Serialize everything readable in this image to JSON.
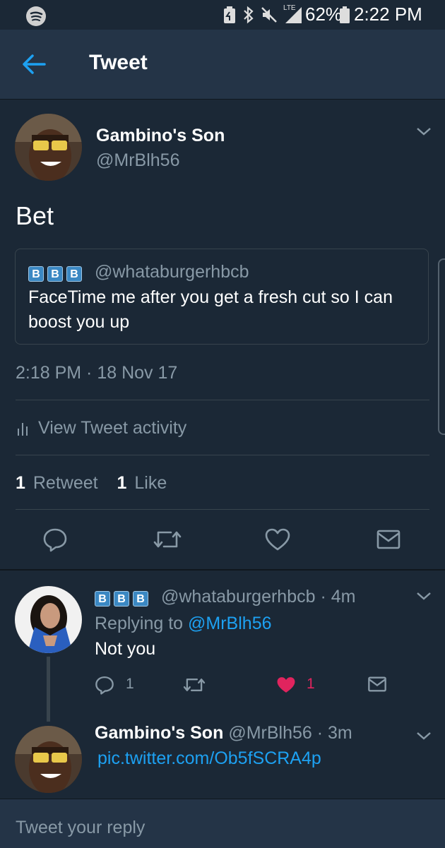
{
  "status_bar": {
    "battery_percent": "62%",
    "time": "2:22 PM",
    "network": "LTE",
    "icons": [
      "spotify-icon",
      "battery-saver-icon",
      "bluetooth-icon",
      "mute-icon",
      "signal-icon",
      "battery-icon"
    ]
  },
  "header": {
    "title": "Tweet"
  },
  "main_tweet": {
    "display_name": "Gambino's Son",
    "handle": "@MrBlh56",
    "text": "Bet",
    "quoted": {
      "badges": [
        "B",
        "B",
        "B"
      ],
      "handle": "@whataburgerhbcb",
      "text_line1": "FaceTime me after you get a fresh cut so I can",
      "text_line2": "boost you up"
    },
    "timestamp": "2:18 PM · 18 Nov 17",
    "activity_label": "View Tweet activity",
    "retweet_count": "1",
    "retweet_label": "Retweet",
    "like_count": "1",
    "like_label": "Like"
  },
  "replies": [
    {
      "badges": [
        "B",
        "B",
        "B"
      ],
      "handle": "@whataburgerhbcb",
      "time": "· 4m",
      "replying_prefix": "Replying to",
      "replying_to": "@MrBlh56",
      "text": "Not you",
      "reply_count": "1",
      "like_count": "1",
      "liked": true
    },
    {
      "display_name": "Gambino's Son",
      "handle": "@MrBlh56",
      "time": "· 3m",
      "link": "pic.twitter.com/Ob5fSCRA4p"
    }
  ],
  "compose": {
    "placeholder": "Tweet your reply"
  },
  "colors": {
    "background": "#1b2836",
    "header": "#243447",
    "accent": "#1da1f2",
    "like": "#e0245e",
    "muted": "#8899a6"
  }
}
